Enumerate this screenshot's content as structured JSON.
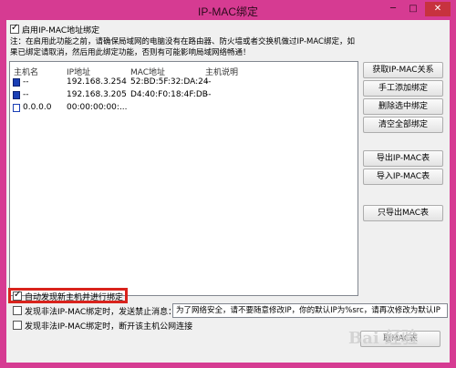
{
  "window": {
    "title": "IP-MAC绑定",
    "controls": {
      "minimize": "─",
      "maximize": "□",
      "close": "✕"
    }
  },
  "enable_binding": {
    "label": "启用IP-MAC地址绑定",
    "checked": true
  },
  "notice": {
    "line1": "注：在启用此功能之前，请确保局域网的电脑没有在路由器、防火墙或者交换机做过IP-MAC绑定，如",
    "line2": "果已绑定请取消，然后用此绑定功能，否则有可能影响局域网络畅通！"
  },
  "table": {
    "columns": [
      "主机名",
      "IP地址",
      "MAC地址",
      "主机说明"
    ],
    "rows": [
      {
        "host": "--",
        "ip": "192.168.3.254",
        "mac": "52:BD:5F:32:DA:24",
        "desc": "--",
        "icon": "computer-icon"
      },
      {
        "host": "--",
        "ip": "192.168.3.205",
        "mac": "D4:40:F0:18:4F:DB",
        "desc": "--",
        "icon": "computer-icon"
      },
      {
        "host": "0.0.0.0",
        "ip": "00:00:00:00:...",
        "mac": "",
        "desc": "",
        "icon": "computer-icon"
      }
    ]
  },
  "buttons": {
    "get_relation": "获取IP-MAC关系",
    "manual_add": "手工添加绑定",
    "delete_selected": "删除选中绑定",
    "clear_all": "清空全部绑定",
    "export_ipmac": "导出IP-MAC表",
    "import_ipmac": "导入IP-MAC表",
    "export_mac_only": "只导出MAC表",
    "bottom_partial": "取MAC表"
  },
  "options": {
    "auto_discover": {
      "label": "自动发现新主机并进行绑定",
      "checked": true
    },
    "send_message": {
      "label": "发现非法IP-MAC绑定时，发送禁止消息：",
      "checked": false
    },
    "disconnect": {
      "label": "发现非法IP-MAC绑定时，断开该主机公网连接",
      "checked": false
    }
  },
  "message_text": "为了网络安全，请不要随意修改IP，你的默认IP为%src，请再次修改为默认IP",
  "watermark": "Bai 经验"
}
